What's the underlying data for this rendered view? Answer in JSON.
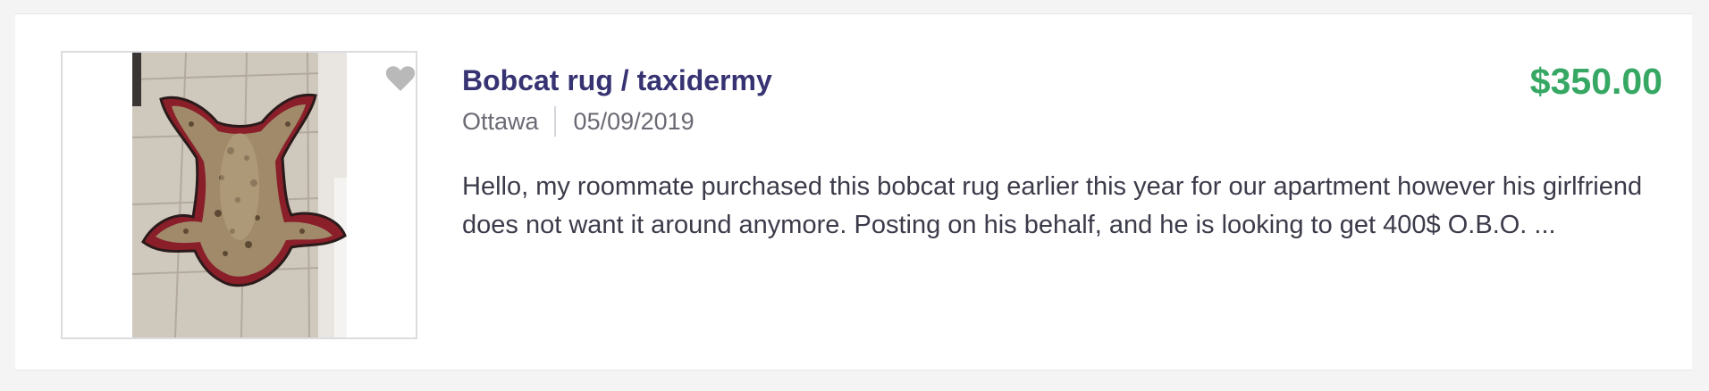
{
  "listing": {
    "title": "Bobcat rug / taxidermy",
    "price": "$350.00",
    "location": "Ottawa",
    "date": "05/09/2019",
    "description": "Hello, my roommate purchased this bobcat rug earlier this year for our apartment however his girlfriend does not want it around anymore. Posting on his behalf, and he is looking to get 400$ O.B.O. ...",
    "favorite_icon": "heart-icon",
    "colors": {
      "title": "#373373",
      "price": "#37a864",
      "meta": "#6a6a74",
      "body": "#3b3b4a",
      "heart": "#b9b9b9"
    }
  }
}
